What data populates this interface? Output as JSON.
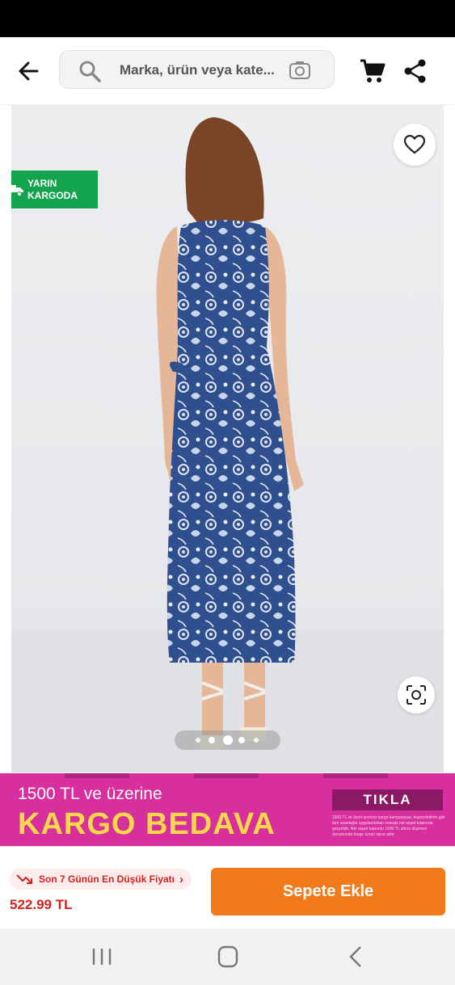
{
  "search": {
    "placeholder": "Marka, ürün veya kate..."
  },
  "header": {
    "back_icon": "arrow-left-icon",
    "cart_icon": "cart-icon",
    "share_icon": "share-icon"
  },
  "gallery": {
    "badge_label": "YARIN KARGODA",
    "badge_color": "#14a44d",
    "dots_count": 5,
    "active_dot_index": 2
  },
  "promo": {
    "line1": "1500 TL ve üzerine",
    "line2": "KARGO BEDAVA",
    "cta": "TIKLA",
    "fine_print": "1500 TL ve üzeri ücretsiz kargo kampanyası, kupon/indirim gibi tüm avantajlar uygulandıktan sonraki net sepet tutarında geçerlidir. Net sepet tutarının 1500 TL altına düşmesi durumunda kargo ücreti sizce adlır.",
    "background_color": "#d72f9d",
    "headline_color": "#f9d949"
  },
  "bottom": {
    "lowest_price_label": "Son 7 Günün En Düşük Fiyatı",
    "price": "522.99 TL",
    "add_to_cart": "Sepete Ekle",
    "accent_color": "#f27a1a",
    "price_color": "#d32222"
  },
  "navbar": {
    "recents_icon": "recents-icon",
    "home_icon": "home-icon",
    "back_icon": "nav-back-icon"
  }
}
